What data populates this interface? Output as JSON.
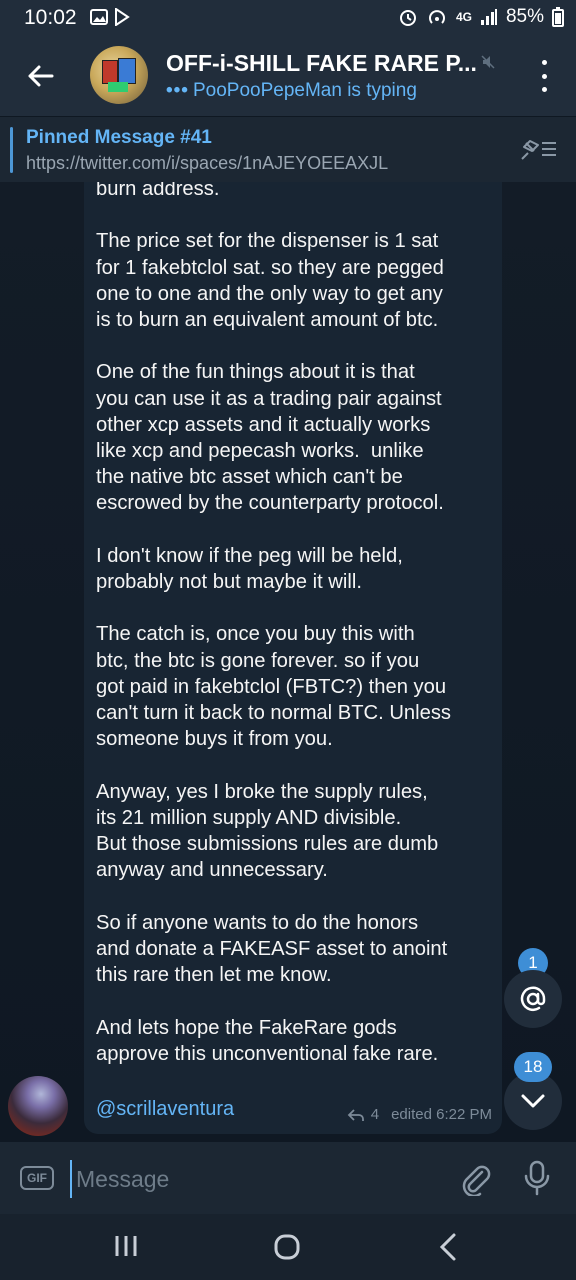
{
  "status_bar": {
    "time": "10:02",
    "battery": "85%",
    "network": "4G"
  },
  "header": {
    "title": "OFF-i-SHILL FAKE RARE P...",
    "typing_dots": "•••",
    "typing_text": "PooPooPepeMan is typing"
  },
  "pinned": {
    "title": "Pinned Message #41",
    "text": "https://twitter.com/i/spaces/1nAJEYOEEAXJL"
  },
  "message": {
    "body": "burn address.\n\nThe price set for the dispenser is 1 sat\nfor 1 fakebtclol sat. so they are pegged\none to one and the only way to get any\nis to burn an equivalent amount of btc.\n\nOne of the fun things about it is that\nyou can use it as a trading pair against\nother xcp assets and it actually works\nlike xcp and pepecash works.  unlike\nthe native btc asset which can't be\nescrowed by the counterparty protocol.\n\nI don't know if the peg will be held,\nprobably not but maybe it will.\n\nThe catch is, once you buy this with\nbtc, the btc is gone forever. so if you\ngot paid in fakebtclol (FBTC?) then you\ncan't turn it back to normal BTC. Unless\nsomeone buys it from you.\n\nAnyway, yes I broke the supply rules,\nits 21 million supply AND divisible.\nBut those submissions rules are dumb\nanyway and unnecessary.\n\nSo if anyone wants to do the honors\nand donate a FAKEASF asset to anoint\nthis rare then let me know.\n\nAnd lets hope the FakeRare gods\napprove this unconventional fake rare.",
    "mention": "@scrillaventura",
    "reply_count": "4",
    "edited_time": "edited 6:22 PM"
  },
  "fabs": {
    "mention_count": "1",
    "unread_count": "18"
  },
  "input": {
    "gif_label": "GIF",
    "placeholder": "Message"
  },
  "colors": {
    "accent": "#64b5f6",
    "badge": "#3e8ed6",
    "header_bg": "#212d3b",
    "bubble_bg": "#182533",
    "chat_bg": "#0e1621"
  }
}
